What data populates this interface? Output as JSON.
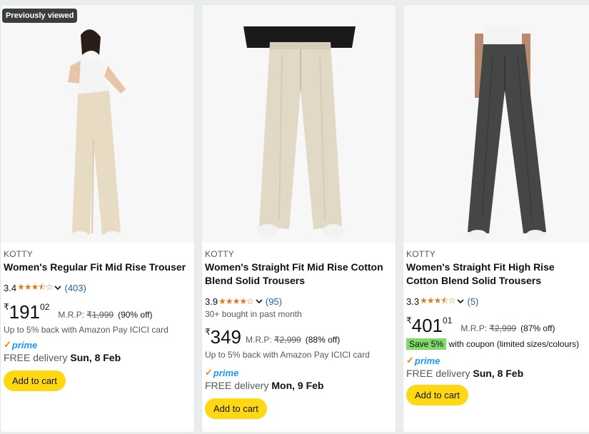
{
  "colors": {
    "accent_cart": "#ffd814",
    "star": "#de7921",
    "link": "#2162a1",
    "prime_blue": "#1a98ff",
    "save_badge": "#7fda69"
  },
  "products": [
    {
      "badge": "Previously viewed",
      "brand": "KOTTY",
      "title": "Women's Regular Fit Mid Rise Trouser",
      "rating": "3.4",
      "stars": "★★★⯪☆",
      "reviews": "(403)",
      "bought": "",
      "price_symbol": "₹",
      "price_whole": "191",
      "price_fraction": "02",
      "mrp_label": "M.R.P:",
      "mrp_value": "₹1,999",
      "discount": "(90% off)",
      "offer": "Up to 5% back with Amazon Pay ICICI card",
      "prime_check": "✓",
      "prime_label": "prime",
      "delivery_text": "FREE delivery",
      "delivery_date": "Sun, 8 Feb",
      "cart_label": "Add to cart"
    },
    {
      "brand": "KOTTY",
      "title": "Women's Straight Fit Mid Rise Cotton Blend Solid Trousers",
      "rating": "3.9",
      "stars": "★★★★☆",
      "reviews": "(95)",
      "bought": "30+ bought in past month",
      "price_symbol": "₹",
      "price_whole": "349",
      "mrp_label": "M.R.P:",
      "mrp_value": "₹2,999",
      "discount": "(88% off)",
      "offer": "Up to 5% back with Amazon Pay ICICI card",
      "prime_check": "✓",
      "prime_label": "prime",
      "delivery_text": "FREE delivery",
      "delivery_date": "Mon, 9 Feb",
      "cart_label": "Add to cart"
    },
    {
      "brand": "KOTTY",
      "title": "Women's Straight Fit High Rise Cotton Blend Solid Trousers",
      "rating": "3.3",
      "stars": "★★★⯪☆",
      "reviews": "(5)",
      "price_symbol": "₹",
      "price_whole": "401",
      "price_fraction": "01",
      "mrp_label": "M.R.P:",
      "mrp_value": "₹2,999",
      "discount": "(87% off)",
      "save_badge": "Save 5%",
      "coupon_text": "with coupon (limited sizes/colours)",
      "prime_check": "✓",
      "prime_label": "prime",
      "delivery_text": "FREE delivery",
      "delivery_date": "Sun, 8 Feb",
      "cart_label": "Add to cart"
    }
  ]
}
